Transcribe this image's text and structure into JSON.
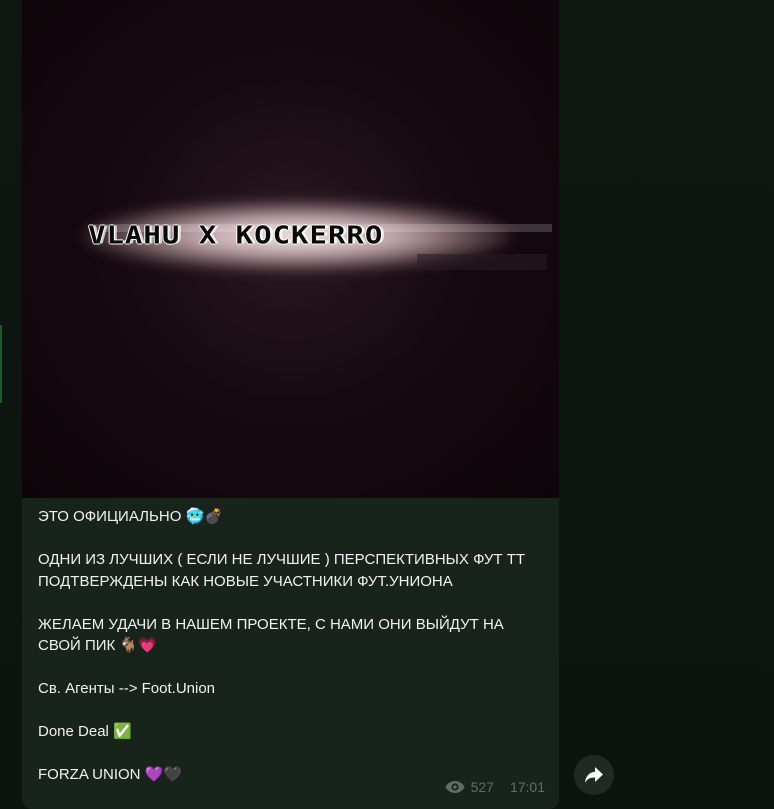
{
  "media": {
    "title": "VLAHU X KOCKERRO"
  },
  "message": {
    "paragraphs": [
      "ЭТО ОФИЦИАЛЬНО 🥶💣",
      "ОДНИ ИЗ ЛУЧШИХ ( ЕСЛИ НЕ ЛУЧШИЕ ) ПЕРСПЕКТИВНЫХ ФУТ ТТ ПОДТВЕРЖДЕНЫ КАК НОВЫЕ УЧАСТНИКИ ФУТ.УНИОНА",
      "ЖЕЛАЕМ УДАЧИ В НАШЕМ ПРОЕКТЕ, С НАМИ ОНИ ВЫЙДУТ НА СВОЙ ПИК 🐐💗",
      "Св. Агенты --> Foot.Union",
      "Done Deal ✅",
      "FORZA UNION 💜🖤"
    ],
    "views": "527",
    "time": "17:01"
  },
  "icons": {
    "views": "eye-icon",
    "share": "share-arrow-icon"
  },
  "colors": {
    "bubble": "#18231c",
    "background": "#0e1410",
    "meta_text": "#5f6d63"
  }
}
